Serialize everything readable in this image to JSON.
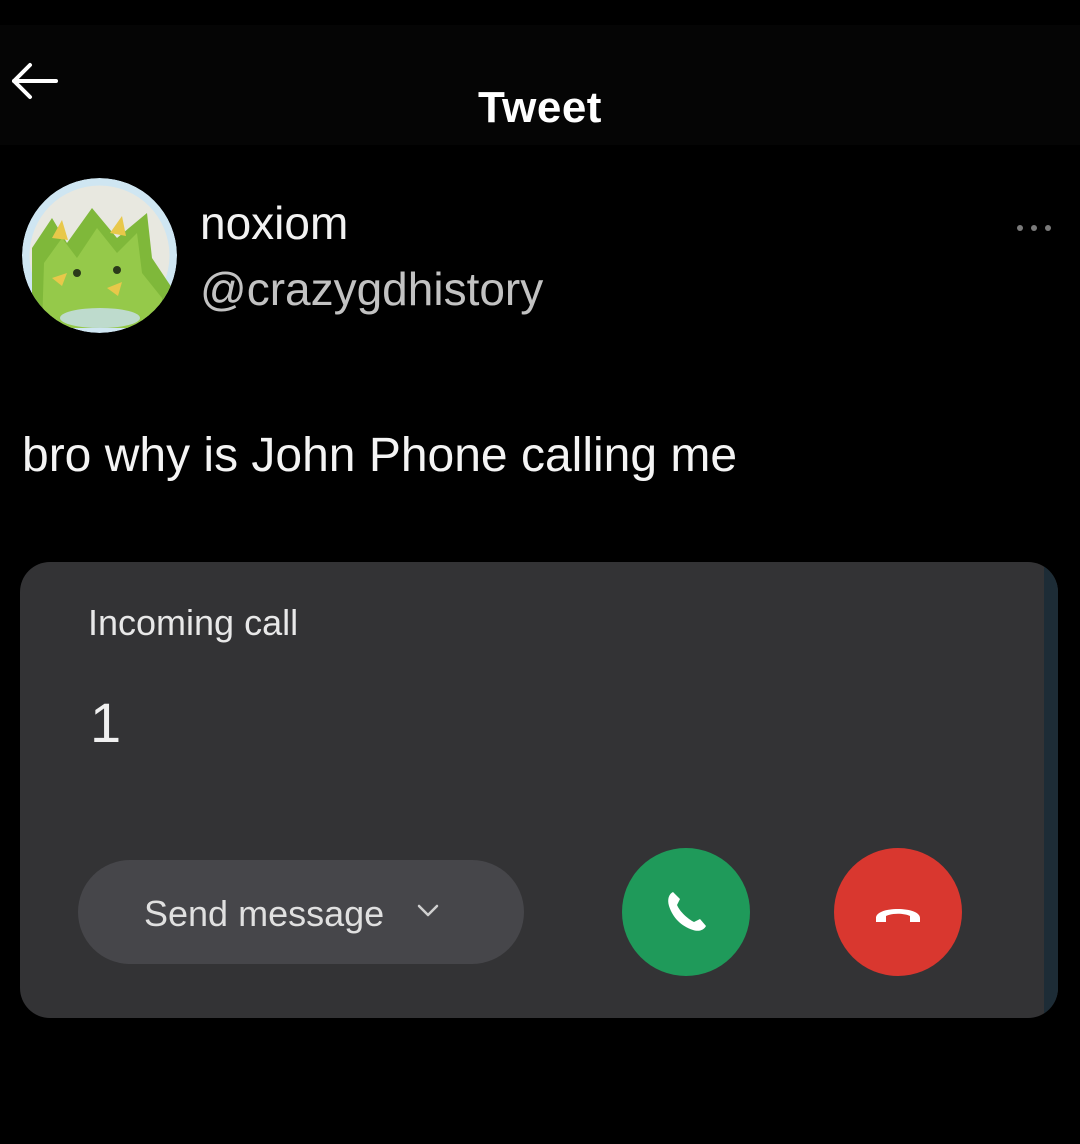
{
  "header": {
    "title": "Tweet",
    "back_icon": "arrow-left-icon"
  },
  "tweet": {
    "author": {
      "display_name": "noxiom",
      "handle": "@crazygdhistory",
      "avatar_icon": "cat-avatar"
    },
    "more_icon": "more-horizontal-icon",
    "text": "bro why is John Phone calling me"
  },
  "call_screenshot": {
    "label": "Incoming call",
    "caller": "1",
    "send_message_label": "Send message",
    "send_message_icon": "chevron-down-icon",
    "accept_icon": "phone-icon",
    "decline_icon": "phone-hangup-icon",
    "colors": {
      "accept": "#1f9a5a",
      "decline": "#d9372f",
      "card": "#333335"
    }
  }
}
